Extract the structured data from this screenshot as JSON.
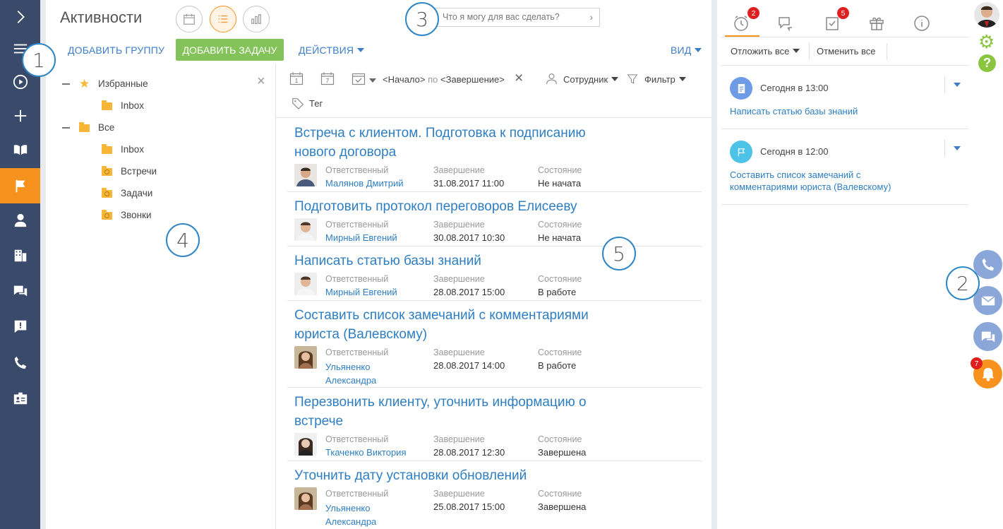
{
  "page": {
    "title": "Активности"
  },
  "sidebar": {
    "items": [
      "expand-icon",
      "menu-icon",
      "play-icon",
      "plus-icon",
      "book-icon",
      "flag-icon",
      "person-icon",
      "building-icon",
      "chat-icon",
      "alert-icon",
      "phone-icon",
      "id-card-icon"
    ]
  },
  "toolbar": {
    "add_group": "ДОБАВИТЬ ГРУППУ",
    "add_task": "ДОБАВИТЬ ЗАДАЧУ",
    "actions": "ДЕЙСТВИЯ",
    "view": "ВИД"
  },
  "search": {
    "placeholder": "Что я могу для вас сделать?"
  },
  "markers": [
    "1",
    "2",
    "3",
    "4",
    "5"
  ],
  "tree": {
    "favorites": "Избранные",
    "fav_inbox": "Inbox",
    "all": "Все",
    "inbox": "Inbox",
    "meetings": "Встречи",
    "tasks": "Задачи",
    "calls": "Звонки"
  },
  "filters": {
    "start": "<Начало>",
    "by": "по",
    "end": "<Завершение>",
    "employee": "Сотрудник",
    "filter": "Фильтр",
    "tag": "Тег",
    "cal_day": "1",
    "cal_week": "7"
  },
  "columns": {
    "owner": "Ответственный",
    "due": "Завершение",
    "status": "Состояние"
  },
  "activities": [
    {
      "title": "Встреча с клиентом. Подготовка к подписанию нового договора",
      "owner": "Малянов Дмитрий",
      "due": "31.08.2017 11:00",
      "status": "Не начата"
    },
    {
      "title": "Подготовить протокол переговоров Елисееву",
      "owner": "Мирный Евгений",
      "due": "30.08.2017 10:30",
      "status": "Не начата"
    },
    {
      "title": "Написать статью базы знаний",
      "owner": "Мирный Евгений",
      "due": "28.08.2017 15:00",
      "status": "В работе"
    },
    {
      "title": "Составить список замечаний с комментариями юриста (Валевскому)",
      "owner": "Ульяненко Александра",
      "due": "28.08.2017 14:00",
      "status": "В работе"
    },
    {
      "title": "Перезвонить клиенту, уточнить информацию о встрече",
      "owner": "Ткаченко Виктория",
      "due": "28.08.2017 12:30",
      "status": "Завершена"
    },
    {
      "title": "Уточнить дату установки обновлений",
      "owner": "Ульяненко Александра",
      "due": "25.08.2017 15:00",
      "status": "Завершена"
    }
  ],
  "right_panel": {
    "tabs": [
      "clock-icon",
      "feed-icon",
      "task-check-icon",
      "gift-icon",
      "info-icon"
    ],
    "badge_reminders": "2",
    "badge_tasks": "5",
    "postpone_all": "Отложить все",
    "cancel_all": "Отменить все",
    "notifications": [
      {
        "time": "Сегодня в 13:00",
        "text": "Написать статью базы знаний",
        "icon": "document-icon",
        "color": "#6e9be6"
      },
      {
        "time": "Сегодня в 12:00",
        "text": "Составить список замечаний с комментариями юриста (Валевскому)",
        "icon": "flag-icon",
        "color": "#4dc3e8"
      }
    ],
    "bell_badge": "7"
  },
  "colors": {
    "sidebar": "#3a4a6b",
    "accent": "#f7921e",
    "green": "#84c25a",
    "link": "#2e7ec1",
    "comm": "#8ba7d9"
  }
}
